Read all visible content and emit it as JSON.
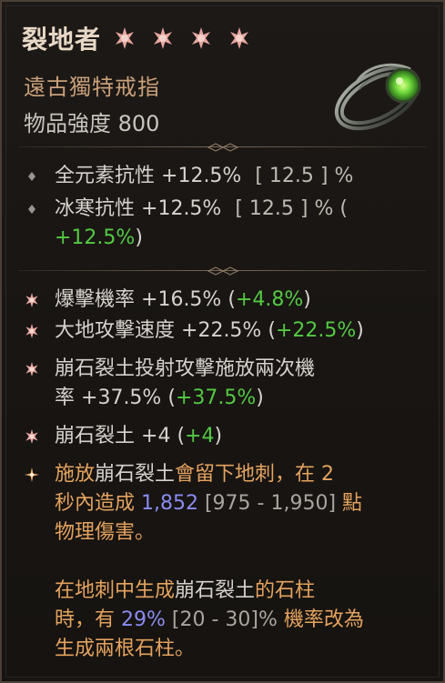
{
  "item": {
    "name": "裂地者",
    "rarity_stars": 4,
    "type": "遠古獨特戒指",
    "power_label": "物品強度",
    "power_value": "800"
  },
  "implicits": [
    {
      "line1_label": "全元素抗性",
      "line1_value": "+12.5%",
      "line1_range": "[ 12.5 ] %"
    },
    {
      "line1_label": "冰寒抗性",
      "line1_value": "+12.5%",
      "line1_range": "[ 12.5 ] % (",
      "line2_bonus": "+12.5%",
      "line2_close": ")"
    }
  ],
  "affixes": [
    {
      "label": "爆擊機率",
      "value": "+16.5%",
      "open": "(",
      "bonus": "+4.8%",
      "close": ")"
    },
    {
      "label": "大地攻擊速度",
      "value": "+22.5%",
      "open": "(",
      "bonus": "+22.5%",
      "close": ")"
    },
    {
      "label_line1": "崩石裂土投射攻擊施放兩次機",
      "label_line2": "率",
      "value": "+37.5%",
      "open": "(",
      "bonus": "+37.5%",
      "close": ")"
    },
    {
      "label": "崩石裂土",
      "value": "+4",
      "open": "(",
      "bonus": "+4",
      "close": ")"
    }
  ],
  "unique_power": {
    "p1_a": "施放",
    "p1_b": "崩石裂土",
    "p1_c": "會留下地刺，在 2",
    "p2_a": "秒內造成 ",
    "p2_value": "1,852",
    "p2_range": " [975 - 1,950]",
    "p2_b": " 點",
    "p3": "物理傷害。",
    "p4_a": "在地刺中生成",
    "p4_b": "崩石裂土",
    "p4_c": "的石柱",
    "p5_a": "時，有 ",
    "p5_value": "29%",
    "p5_range": " [20 - 30]%",
    "p5_b": " 機率改為",
    "p6": "生成兩根石柱。"
  },
  "colors": {
    "title": "#e8d8c6",
    "item_type": "#c9a07a",
    "bonus_green": "#53c943",
    "legendary_orange": "#e4a35f",
    "roll_blue": "#8a8cf0"
  }
}
